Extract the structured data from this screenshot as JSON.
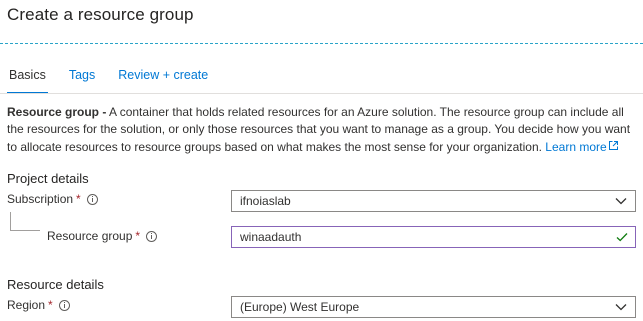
{
  "page": {
    "title": "Create a resource group"
  },
  "tabs": [
    {
      "label": "Basics",
      "active": true
    },
    {
      "label": "Tags",
      "active": false
    },
    {
      "label": "Review + create",
      "active": false
    }
  ],
  "description": {
    "bold": "Resource group -",
    "text": " A container that holds related resources for an Azure solution. The resource group can include all the resources for the solution, or only those resources that you want to manage as a group. You decide how you want to allocate resources to resource groups based on what makes the most sense for your organization. ",
    "learn_more": "Learn more"
  },
  "project_details": {
    "heading": "Project details",
    "subscription": {
      "label": "Subscription",
      "required": "*",
      "value": "ifnoiaslab"
    },
    "resource_group": {
      "label": "Resource group",
      "required": "*",
      "value": "winaadauth"
    }
  },
  "resource_details": {
    "heading": "Resource details",
    "region": {
      "label": "Region",
      "required": "*",
      "value": "(Europe) West Europe"
    }
  },
  "colors": {
    "accent": "#0078d4",
    "required": "#a4262c",
    "valid_border": "#8764b8",
    "check": "#107c10"
  }
}
